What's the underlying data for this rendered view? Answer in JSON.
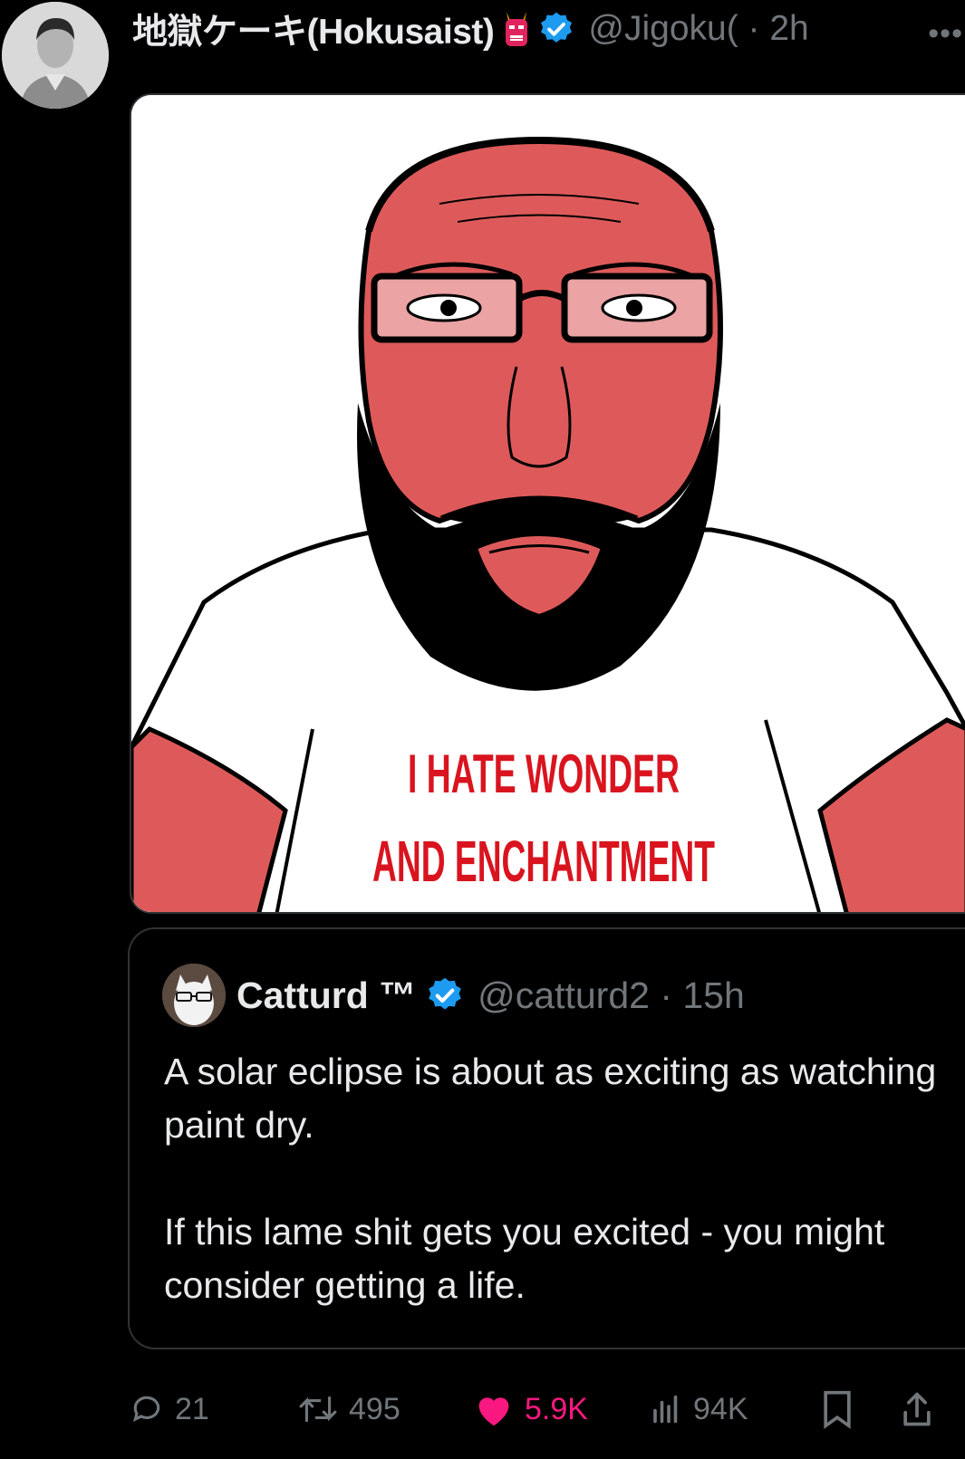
{
  "post": {
    "display_name": "地獄ケーキ(Hokusaist)",
    "handle_time": "@Jigoku( · 2h",
    "more_label": "•••"
  },
  "quote": {
    "display_name": "Catturd ™",
    "handle_time": "@catturd2 · 15h",
    "paragraphs": [
      "A solar eclipse is about as exciting as watching paint dry.",
      "If this lame shit gets you excited - you might consider getting a life."
    ]
  },
  "media": {
    "shirt_text_line1": "I HATE WONDER",
    "shirt_text_line2": "AND ENCHANTMENT"
  },
  "actions": {
    "replies": "21",
    "reposts": "495",
    "likes": "5.9K",
    "views": "94K"
  },
  "colors": {
    "background": "#000000",
    "text": "#e7e9ea",
    "muted": "#71767b",
    "verified": "#1d9bf0",
    "like": "#f91880",
    "face": "#de5a5a",
    "shirt_text": "#d9141f"
  },
  "icons": [
    "more-icon",
    "verified-icon",
    "oni-icon",
    "reply-icon",
    "repost-icon",
    "like-icon",
    "views-icon",
    "bookmark-icon",
    "share-icon"
  ]
}
